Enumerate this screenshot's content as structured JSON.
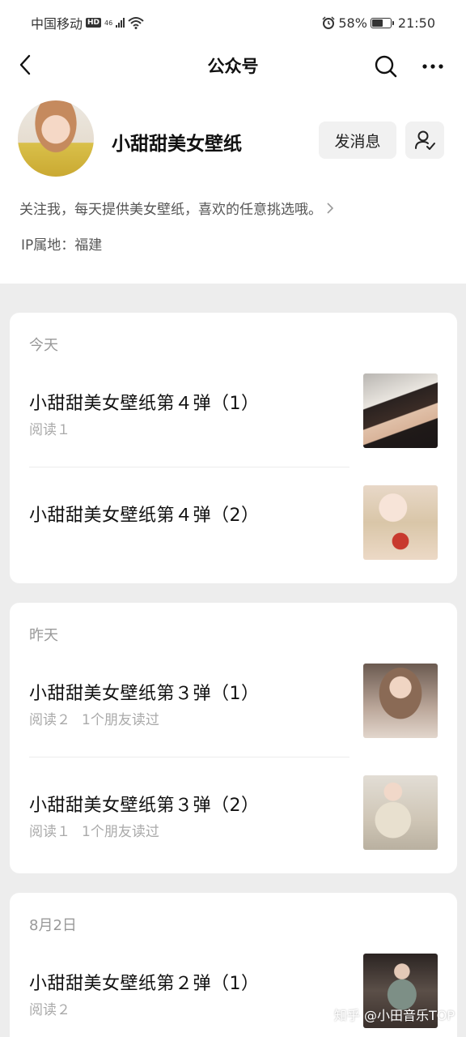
{
  "status_bar": {
    "carrier": "中国移动",
    "hd_badge": "HD",
    "network": "46",
    "battery": "58%",
    "battery_level": 0.58,
    "time": "21:50"
  },
  "nav": {
    "title": "公众号"
  },
  "account": {
    "name": "小甜甜美女壁纸",
    "message_button": "发消息",
    "description": "关注我，每天提供美女壁纸，喜欢的任意挑选哦。",
    "ip_location": "IP属地：福建"
  },
  "groups": [
    {
      "date": "今天",
      "articles": [
        {
          "title": "小甜甜美女壁纸第４弹（1）",
          "reads": "阅读１",
          "friends": ""
        },
        {
          "title": "小甜甜美女壁纸第４弹（2）",
          "reads": "",
          "friends": ""
        }
      ]
    },
    {
      "date": "昨天",
      "articles": [
        {
          "title": "小甜甜美女壁纸第３弹（1）",
          "reads": "阅读２",
          "friends": "1个朋友读过"
        },
        {
          "title": "小甜甜美女壁纸第３弹（2）",
          "reads": "阅读１",
          "friends": "1个朋友读过"
        }
      ]
    },
    {
      "date": "8月2日",
      "articles": [
        {
          "title": "小甜甜美女壁纸第２弹（1）",
          "reads": "阅读２",
          "friends": ""
        }
      ]
    }
  ],
  "watermark": "知乎 @小田音乐TOP"
}
